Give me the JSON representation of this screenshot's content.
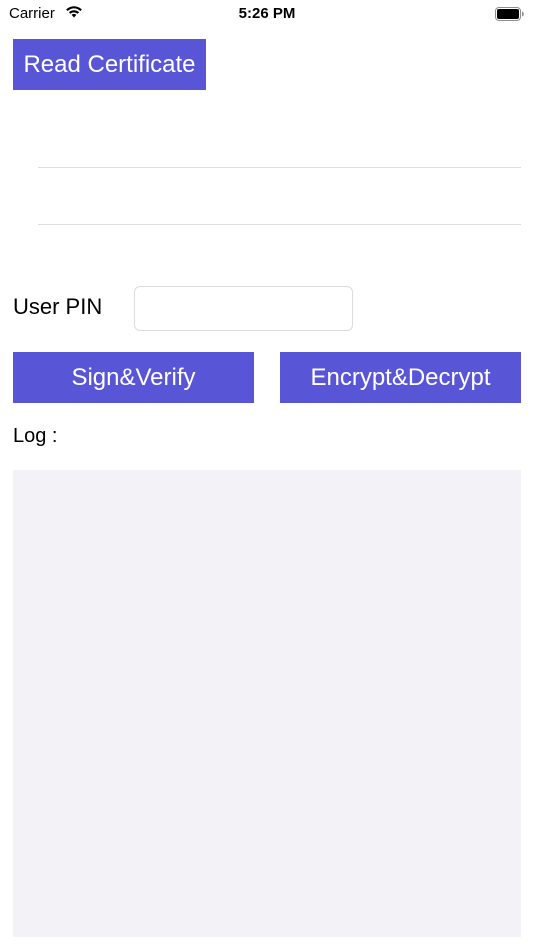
{
  "status_bar": {
    "carrier": "Carrier",
    "time": "5:26 PM",
    "wifi_icon": "wifi-icon",
    "battery_icon": "battery-icon"
  },
  "buttons": {
    "read_certificate": "Read Certificate",
    "sign_verify": "Sign&Verify",
    "encrypt_decrypt": "Encrypt&Decrypt"
  },
  "pin": {
    "label": "User PIN",
    "value": "",
    "placeholder": ""
  },
  "log": {
    "label": "Log :",
    "content": ""
  },
  "colors": {
    "accent": "#5856d6",
    "log_background": "#f2f2f7"
  }
}
